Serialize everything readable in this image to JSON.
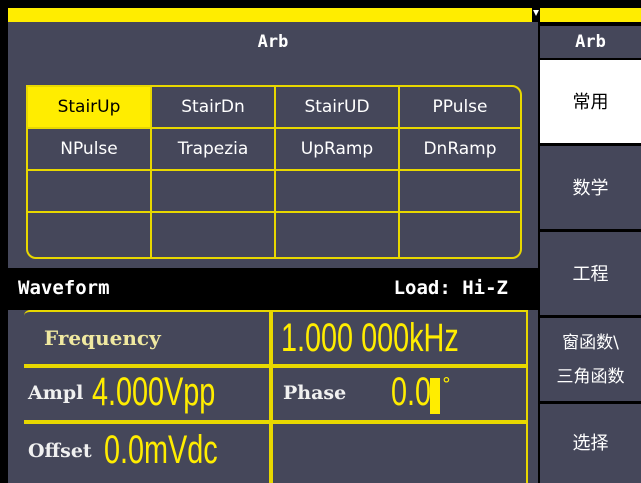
{
  "header": {
    "title": "Arb"
  },
  "menu": {
    "title": "Arb",
    "items": [
      {
        "label": "常用"
      },
      {
        "label": "数学"
      },
      {
        "label": "工程"
      },
      {
        "label1": "窗函数\\",
        "label2": "三角函数"
      },
      {
        "label": "选择"
      }
    ]
  },
  "waveforms": [
    [
      "StairUp",
      "StairDn",
      "StairUD",
      "PPulse"
    ],
    [
      "NPulse",
      "Trapezia",
      "UpRamp",
      "DnRamp"
    ],
    [
      "",
      "",
      "",
      ""
    ],
    [
      "",
      "",
      "",
      ""
    ]
  ],
  "selected": "StairUp",
  "status": {
    "waveform_label": "Waveform",
    "load": "Load: Hi-Z"
  },
  "params": {
    "frequency_label": "Frequency",
    "frequency_value": "1.000 000kHz",
    "ampl_label": "Ampl",
    "ampl_value": "4.000Vpp",
    "phase_label": "Phase",
    "phase_value": "0.0",
    "phase_unit": "°",
    "offset_label": "Offset",
    "offset_value": "0.0mVdc"
  },
  "colors": {
    "accent": "#ffed00",
    "panel": "#45475a",
    "background": "#000000"
  }
}
